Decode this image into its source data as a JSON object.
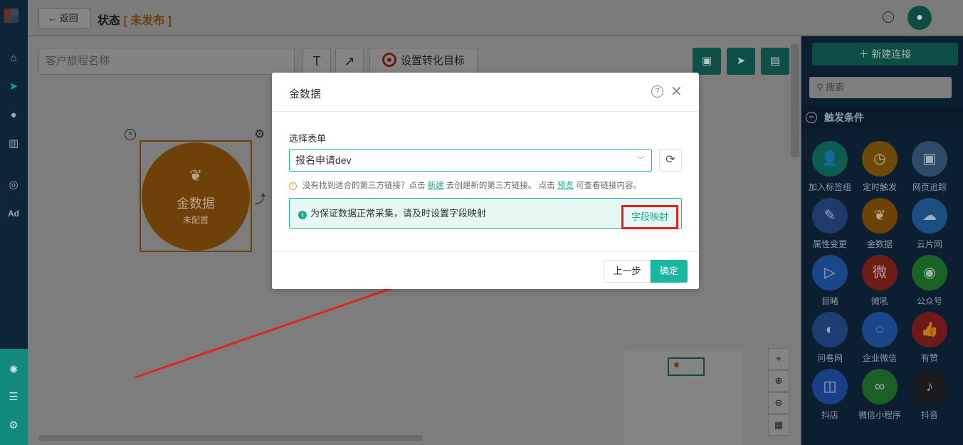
{
  "topbar": {
    "back_label": "返回",
    "title": "状态",
    "status_label": "未发布"
  },
  "toolbar": {
    "journey_placeholder": "客户旅程名称",
    "text_tool": "T",
    "arrow_tool": "↗",
    "conversion_label": "设置转化目标"
  },
  "node": {
    "name": "金数据",
    "status": "未配置"
  },
  "right_panel": {
    "new_connection_label": "新建连接",
    "search_placeholder": "搜索",
    "section_title": "触发条件",
    "items": [
      {
        "label": "加入标签组",
        "color": "#0e5b52",
        "icon": "person-add-icon",
        "glyph": "👤"
      },
      {
        "label": "定时触发",
        "color": "#6b4a09",
        "icon": "clock-icon",
        "glyph": "◷"
      },
      {
        "label": "网页追踪",
        "color": "#2d4b67",
        "icon": "webpage-icon",
        "glyph": "▣"
      },
      {
        "label": "属性变更",
        "color": "#1f3a6b",
        "icon": "edit-icon",
        "glyph": "✎"
      },
      {
        "label": "金数据",
        "color": "#6e4109",
        "icon": "jinshuju-icon",
        "glyph": "❦"
      },
      {
        "label": "云片网",
        "color": "#1b4f80",
        "icon": "cloud-icon",
        "glyph": "☁"
      },
      {
        "label": "目睹",
        "color": "#1a468a",
        "icon": "play-icon",
        "glyph": "▷"
      },
      {
        "label": "微吼",
        "color": "#6d1d17",
        "icon": "weihou-icon",
        "glyph": "微"
      },
      {
        "label": "公众号",
        "color": "#1a6326",
        "icon": "wechat-icon",
        "glyph": "◉"
      },
      {
        "label": "问卷网",
        "color": "#1c3e73",
        "icon": "wenjuan-icon",
        "glyph": "◐"
      },
      {
        "label": "企业微信",
        "color": "#1a468a",
        "icon": "wecom-icon",
        "glyph": "◌"
      },
      {
        "label": "有赞",
        "color": "#6d1a18",
        "icon": "thumbs-up-icon",
        "glyph": "👍"
      },
      {
        "label": "抖店",
        "color": "#1a3f86",
        "icon": "doudian-icon",
        "glyph": "◫"
      },
      {
        "label": "微信小程序",
        "color": "#1a5e28",
        "icon": "miniprogram-icon",
        "glyph": "∞"
      },
      {
        "label": "抖音",
        "color": "#1a1a1f",
        "icon": "tiktok-icon",
        "glyph": "♪"
      }
    ]
  },
  "modal": {
    "title": "金数据",
    "form_label": "选择表单",
    "selected_form": "报名申请dev",
    "hint_prefix": "没有找到适合的第三方链接？点击",
    "hint_new_link": "新建",
    "hint_middle": "去创建新的第三方链接。 点击",
    "hint_preview_link": "预览",
    "hint_suffix": "可查看链接内容。",
    "notice_text": "为保证数据正常采集，请及时设置字段映射",
    "field_map_label": "字段映射",
    "prev_label": "上一步",
    "ok_label": "确定"
  },
  "colors": {
    "accent": "#19b79f",
    "annotation": "#e1241b",
    "node_orange": "#e08a10"
  }
}
